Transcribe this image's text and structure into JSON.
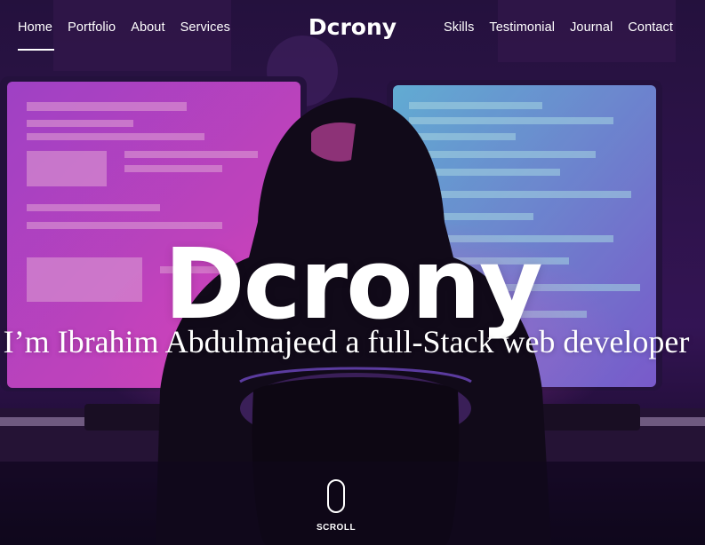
{
  "nav": {
    "left": [
      "Home",
      "Portfolio",
      "About",
      "Services"
    ],
    "right": [
      "Skills",
      "Testimonial",
      "Journal",
      "Contact"
    ],
    "brand": "Dcrony",
    "active": "Home"
  },
  "hero": {
    "title": "Dcrony",
    "subtitle": "I’m Ibrahim Abdulmajeed a full-Stack web developer",
    "scroll_label": "SCROLL"
  },
  "colors": {
    "accent_pink": "#e040c8",
    "accent_cyan": "#45d8f0",
    "background": "#1a0f2e",
    "text": "#ffffff"
  },
  "icons": {
    "scroll_icon": "mouse-scroll-icon"
  }
}
